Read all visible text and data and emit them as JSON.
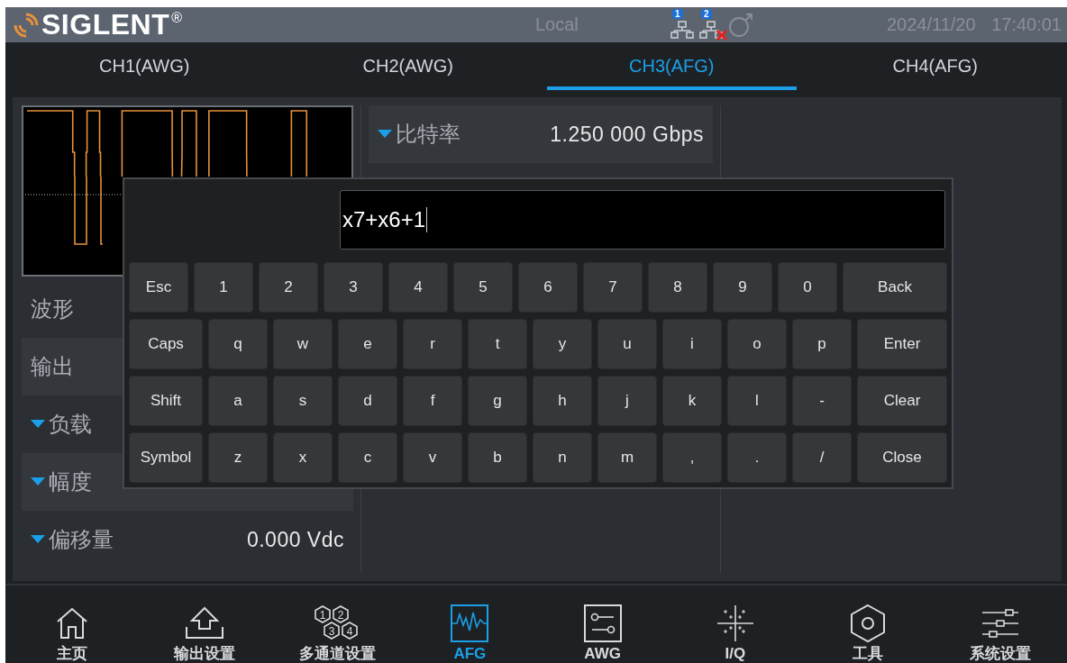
{
  "header": {
    "brand": "SIGLENT",
    "brand_mark": "®",
    "mode": "Local",
    "lan_badges": [
      "1",
      "2"
    ],
    "lan2_disconnected": true,
    "datetime": "2024/11/20 17:40:01"
  },
  "tabs": [
    {
      "label": "CH1(AWG)",
      "selected": false
    },
    {
      "label": "CH2(AWG)",
      "selected": false
    },
    {
      "label": "CH3(AFG)",
      "selected": true
    },
    {
      "label": "CH4(AFG)",
      "selected": false
    }
  ],
  "left_params": [
    {
      "label": "波形",
      "dropdown": false
    },
    {
      "label": "输出",
      "dropdown": false
    },
    {
      "label": "负载",
      "dropdown": true
    },
    {
      "label": "幅度",
      "dropdown": true
    },
    {
      "label": "偏移量",
      "dropdown": true,
      "value": "0.000 Vdc"
    }
  ],
  "middle_params": [
    {
      "label": "比特率",
      "dropdown": true,
      "value": "1.250 000 Gbps"
    }
  ],
  "keyboard": {
    "input_value": "x7+x6+1",
    "rows": [
      [
        {
          "label": "Esc",
          "kind": "key"
        },
        {
          "label": "1",
          "kind": "key"
        },
        {
          "label": "2",
          "kind": "key"
        },
        {
          "label": "3",
          "kind": "key"
        },
        {
          "label": "4",
          "kind": "key"
        },
        {
          "label": "5",
          "kind": "key"
        },
        {
          "label": "6",
          "kind": "key"
        },
        {
          "label": "7",
          "kind": "key"
        },
        {
          "label": "8",
          "kind": "key"
        },
        {
          "label": "9",
          "kind": "key"
        },
        {
          "label": "0",
          "kind": "key"
        },
        {
          "label": "Back",
          "kind": "wide"
        }
      ],
      [
        {
          "label": "Caps",
          "kind": "mod"
        },
        {
          "label": "q",
          "kind": "key"
        },
        {
          "label": "w",
          "kind": "key"
        },
        {
          "label": "e",
          "kind": "key"
        },
        {
          "label": "r",
          "kind": "key"
        },
        {
          "label": "t",
          "kind": "key"
        },
        {
          "label": "y",
          "kind": "key"
        },
        {
          "label": "u",
          "kind": "key"
        },
        {
          "label": "i",
          "kind": "key"
        },
        {
          "label": "o",
          "kind": "key"
        },
        {
          "label": "p",
          "kind": "key"
        },
        {
          "label": "Enter",
          "kind": "wide"
        }
      ],
      [
        {
          "label": "Shift",
          "kind": "mod"
        },
        {
          "label": "a",
          "kind": "key"
        },
        {
          "label": "s",
          "kind": "key"
        },
        {
          "label": "d",
          "kind": "key"
        },
        {
          "label": "f",
          "kind": "key"
        },
        {
          "label": "g",
          "kind": "key"
        },
        {
          "label": "h",
          "kind": "key"
        },
        {
          "label": "j",
          "kind": "key"
        },
        {
          "label": "k",
          "kind": "key"
        },
        {
          "label": "l",
          "kind": "key"
        },
        {
          "label": "-",
          "kind": "key"
        },
        {
          "label": "Clear",
          "kind": "wide"
        }
      ],
      [
        {
          "label": "Symbol",
          "kind": "mod"
        },
        {
          "label": "z",
          "kind": "key"
        },
        {
          "label": "x",
          "kind": "key"
        },
        {
          "label": "c",
          "kind": "key"
        },
        {
          "label": "v",
          "kind": "key"
        },
        {
          "label": "b",
          "kind": "key"
        },
        {
          "label": "n",
          "kind": "key"
        },
        {
          "label": "m",
          "kind": "key"
        },
        {
          "label": ",",
          "kind": "key"
        },
        {
          "label": ".",
          "kind": "key"
        },
        {
          "label": "/",
          "kind": "key"
        },
        {
          "label": "Close",
          "kind": "wide"
        }
      ]
    ]
  },
  "nav": [
    {
      "label": "主页",
      "kind": "home",
      "selected": false
    },
    {
      "label": "输出设置",
      "kind": "export",
      "selected": false
    },
    {
      "label": "多通道设置",
      "kind": "channels",
      "selected": false,
      "icon_digits": [
        "1",
        "2",
        "3",
        "4"
      ]
    },
    {
      "label": "AFG",
      "kind": "afg",
      "selected": true
    },
    {
      "label": "AWG",
      "kind": "awg",
      "selected": false
    },
    {
      "label": "I/Q",
      "kind": "iq",
      "selected": false
    },
    {
      "label": "工具",
      "kind": "tools",
      "selected": false
    },
    {
      "label": "系统设置",
      "kind": "settings",
      "selected": false
    }
  ]
}
